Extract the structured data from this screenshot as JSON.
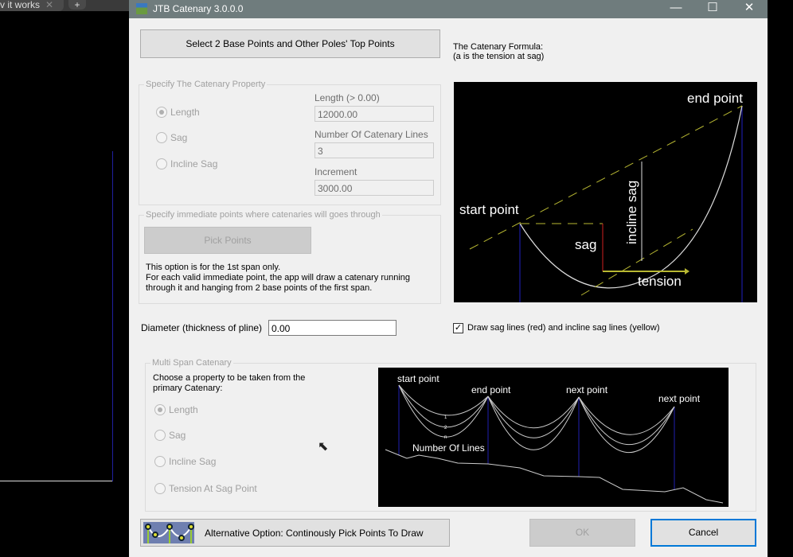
{
  "background": {
    "tab_label": "v it works",
    "tab_close": "✕",
    "new_tab": "+"
  },
  "window": {
    "title": "JTB Catenary 3.0.0.0",
    "minimize": "—",
    "maximize": "☐",
    "close": "✕"
  },
  "select_button": "Select 2 Base Points and Other Poles' Top Points",
  "formula": {
    "line1": "The Catenary Formula:",
    "line2": "(a is the tension at sag)"
  },
  "property_group": {
    "legend": "Specify The Catenary Property",
    "radios": [
      "Length",
      "Sag",
      "Incline Sag"
    ],
    "selected": "Length",
    "length_label": "Length (> 0.00)",
    "length_value": "12000.00",
    "lines_label": "Number Of Catenary Lines",
    "lines_value": "3",
    "increment_label": "Increment",
    "increment_value": "3000.00"
  },
  "immediate_group": {
    "legend": "Specify immediate points where catenaries will goes through",
    "pick_button": "Pick Points",
    "note1": "This option is for the 1st span only.",
    "note2": "For each valid immediate point, the app will draw a catenary running",
    "note3": "through it and  hanging from 2 base points of the first span."
  },
  "diagram1": {
    "end_point": "end point",
    "start_point": "start point",
    "incline_sag": "incline sag",
    "sag": "sag",
    "tension": "tension"
  },
  "diameter": {
    "label": "Diameter (thickness of pline)",
    "value": "0.00"
  },
  "draw_sag_checkbox": {
    "label": "Draw sag lines (red) and incline sag lines (yellow)",
    "checked": true
  },
  "multi_span": {
    "legend": "Multi Span Catenary",
    "prompt1": "Choose a property to be taken from the",
    "prompt2": "primary Catenary:",
    "radios": [
      "Length",
      "Sag",
      "Incline Sag",
      "Tension At Sag Point"
    ],
    "selected": "Length"
  },
  "diagram2": {
    "start_point": "start point",
    "end_point": "end point",
    "next_point_1": "next point",
    "next_point_2": "next point",
    "number_of_lines": "Number Of Lines",
    "n1": "1",
    "n2": "2",
    "n3": "n"
  },
  "alt_button": "Alternative Option: Continously Pick Points To Draw",
  "ok_button": "OK",
  "cancel_button": "Cancel"
}
